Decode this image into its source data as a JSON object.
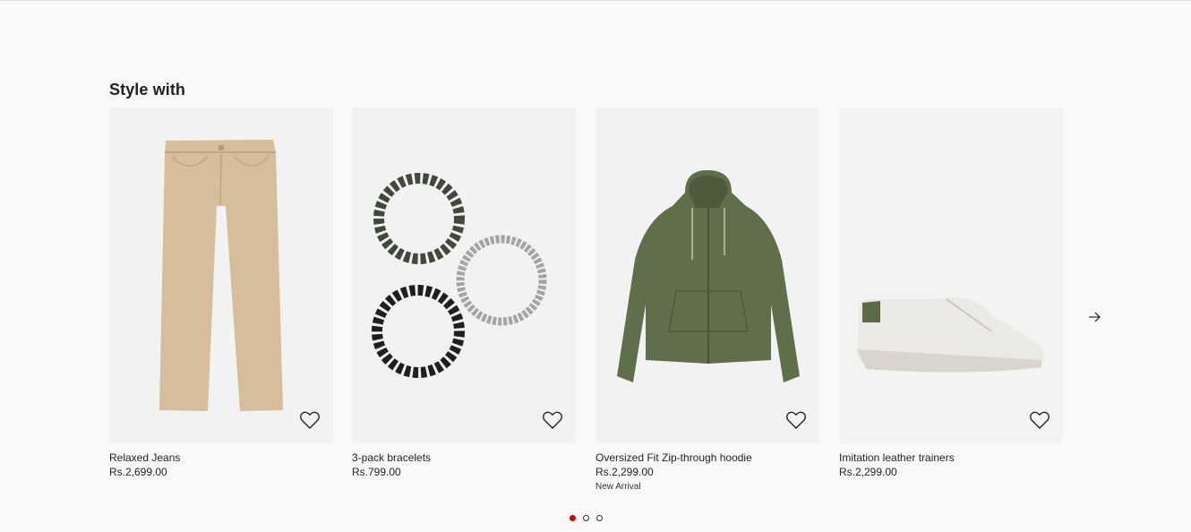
{
  "section": {
    "title": "Style with"
  },
  "products": [
    {
      "name": "Relaxed Jeans",
      "price": "Rs.2,699.00",
      "badge": ""
    },
    {
      "name": "3-pack bracelets",
      "price": "Rs.799.00",
      "badge": ""
    },
    {
      "name": "Oversized Fit Zip-through hoodie",
      "price": "Rs.2,299.00",
      "badge": "New Arrival"
    },
    {
      "name": "Imitation leather trainers",
      "price": "Rs.2,299.00",
      "badge": ""
    }
  ],
  "carousel": {
    "next_icon": "arrow-right-icon",
    "pages": 3,
    "active_page": 1
  },
  "colors": {
    "accent": "#d50000",
    "background": "#faf9f8"
  }
}
